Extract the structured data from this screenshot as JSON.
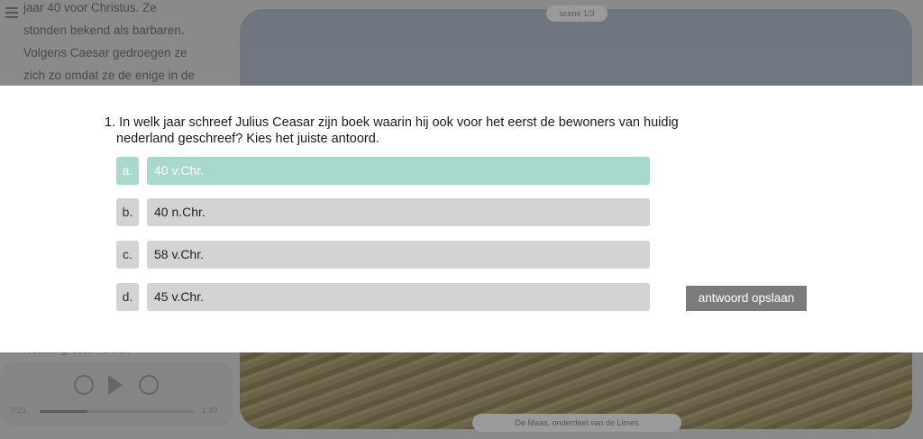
{
  "background": {
    "text_lines": [
      "jaar 40 voor Christus. Ze",
      "stonden bekend als barbaren.",
      "Volgens Caesar gedroegen ze",
      "zich zo omdat ze de enige in de"
    ],
    "scene_badge": "scene 1/3",
    "caption": "Afbeelding: Ceder Au Wen",
    "audio_time_start": "0:21",
    "audio_time_end": "1:49",
    "audio_progress": 0.31,
    "location_label": "De Maas, onderdeel van de Limes"
  },
  "quiz": {
    "question": "1. In welk jaar schreef Julius Ceasar zijn boek waarin hij ook voor het eerst de bewoners van huidig nederland geschreef? Kies het juiste antoord.",
    "options": [
      {
        "letter": "a.",
        "text": "40 v.Chr.",
        "selected": true
      },
      {
        "letter": "b.",
        "text": "40 n.Chr.",
        "selected": false
      },
      {
        "letter": "c.",
        "text": "58 v.Chr.",
        "selected": false
      },
      {
        "letter": "d.",
        "text": "45 v.Chr.",
        "selected": false
      }
    ],
    "save_label": "antwoord opslaan"
  },
  "colors": {
    "selected_option": "#a9d8cd",
    "option_default": "#d3d3d3",
    "save_button": "#7b7b7b"
  }
}
